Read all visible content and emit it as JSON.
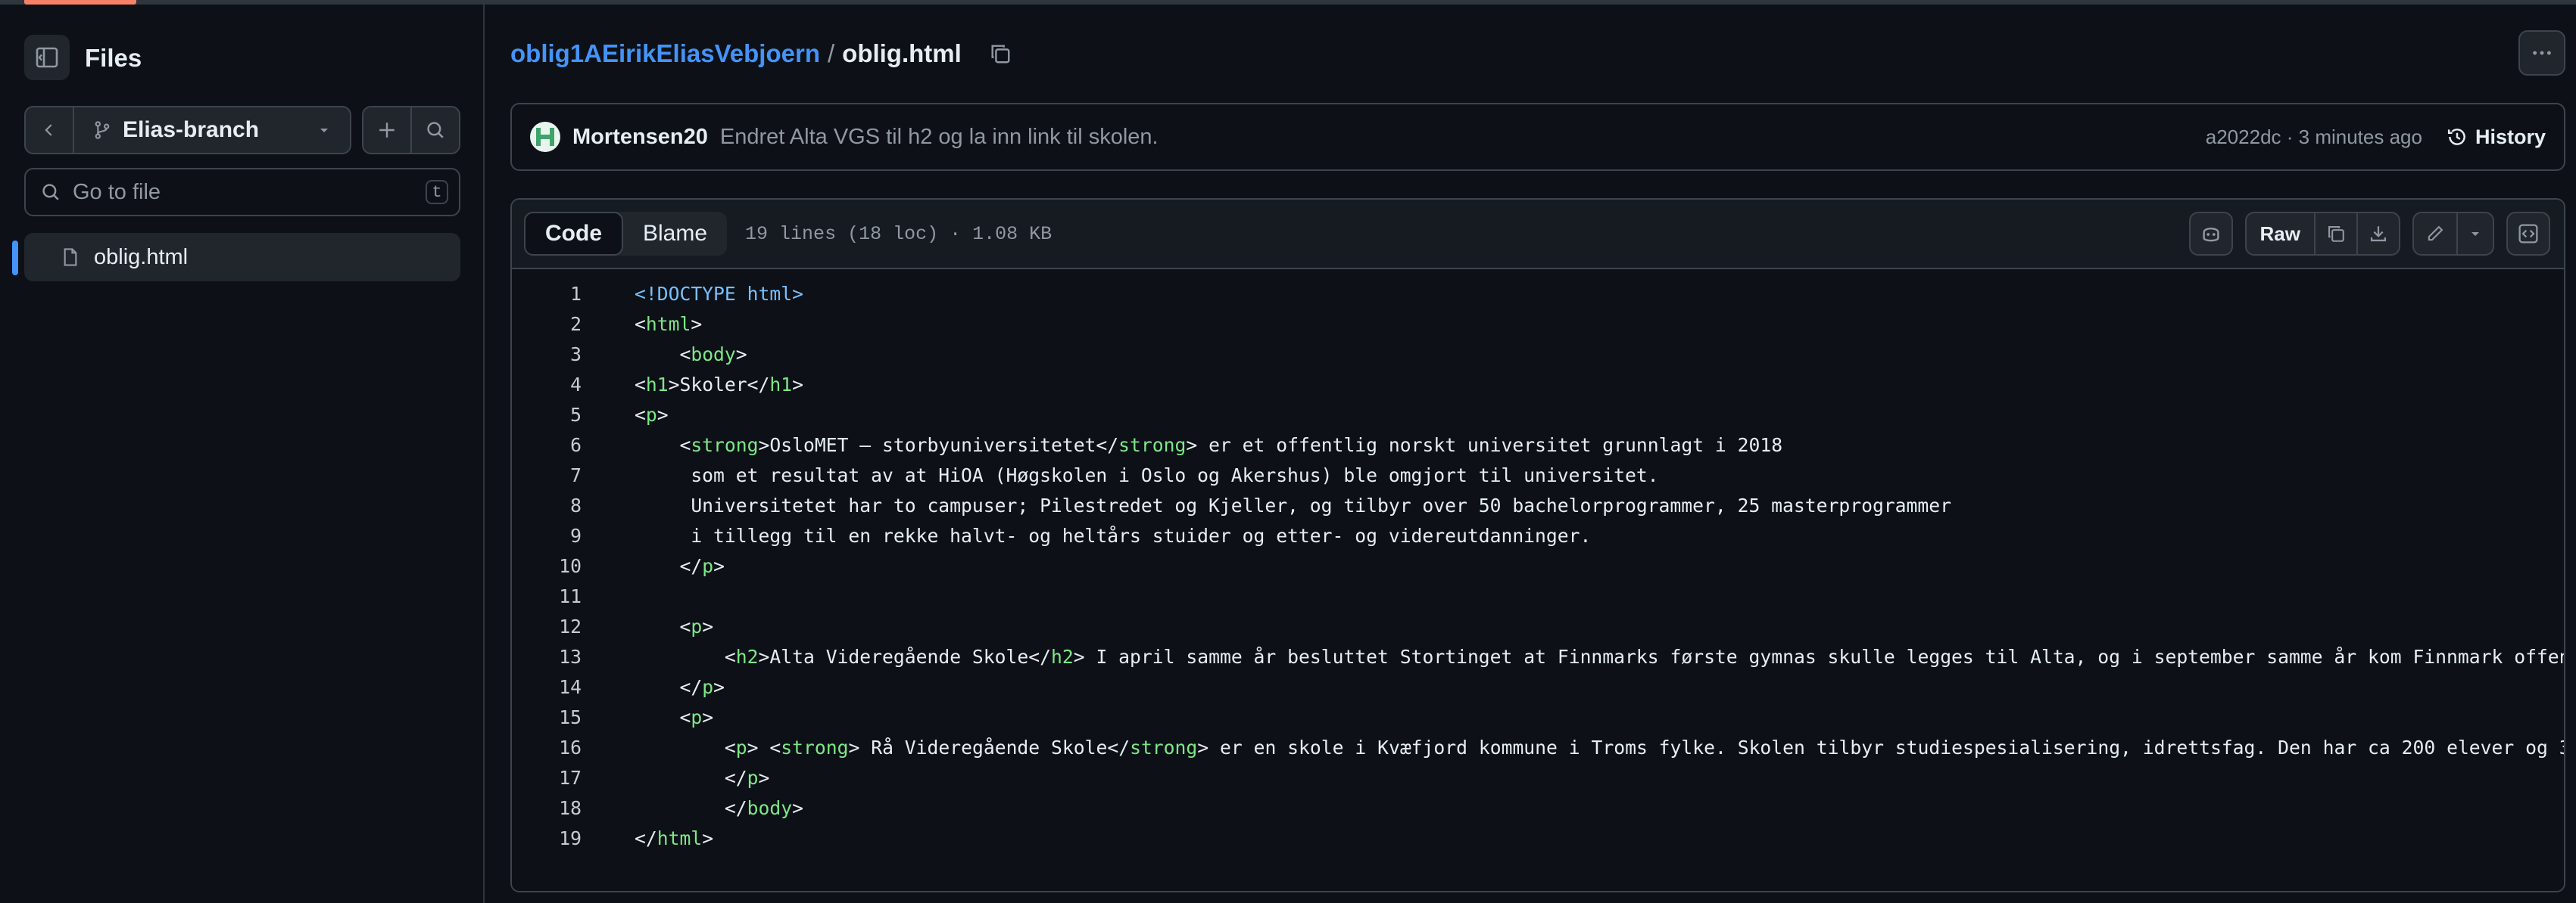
{
  "sidebar": {
    "title": "Files",
    "branch": "Elias-branch",
    "go_to_file_placeholder": "Go to file",
    "go_to_file_shortcut": "t",
    "files": [
      {
        "name": "oblig.html"
      }
    ]
  },
  "breadcrumb": {
    "repo": "oblig1AEirikEliasVebjoern",
    "separator": "/",
    "file": "oblig.html"
  },
  "commit": {
    "author": "Mortensen20",
    "message": "Endret Alta VGS til h2 og la inn link til skolen.",
    "meta": "a2022dc · 3 minutes ago",
    "history_label": "History"
  },
  "file_header": {
    "tabs": [
      "Code",
      "Blame"
    ],
    "active_tab": "Code",
    "info": "19 lines (18 loc) · 1.08 KB",
    "raw_label": "Raw"
  },
  "code_lines": [
    "<!DOCTYPE html>",
    "<html>",
    "    <body>",
    "<h1>Skoler</h1>",
    "<p>",
    "    <strong>OsloMET – storbyuniversitetet</strong> er et offentlig norskt universitet grunnlagt i 2018",
    "     som et resultat av at HiOA (Høgskolen i Oslo og Akershus) ble omgjort til universitet.",
    "     Universitetet har to campuser; Pilestredet og Kjeller, og tilbyr over 50 bachelorprogrammer, 25 masterprogrammer",
    "     i tillegg til en rekke halvt- og heltårs stuider og etter- og videreutdanninger.",
    "    </p>",
    "",
    "    <p>",
    "        <h2>Alta Videregående Skole</h2> I april samme år besluttet Stortinget at Finnmarks første gymnas skulle legges til Alta, og i september samme år kom Finnmark offen",
    "    </p>",
    "    <p>",
    "        <p> <strong> Rå Videregående Skole</strong> er en skole i Kvæfjord kommune i Troms fylke. Skolen tilbyr studiespesialisering, idrettsfag. Den har ca 200 elever og 3",
    "        </p>",
    "        </body>",
    "</html>"
  ]
}
